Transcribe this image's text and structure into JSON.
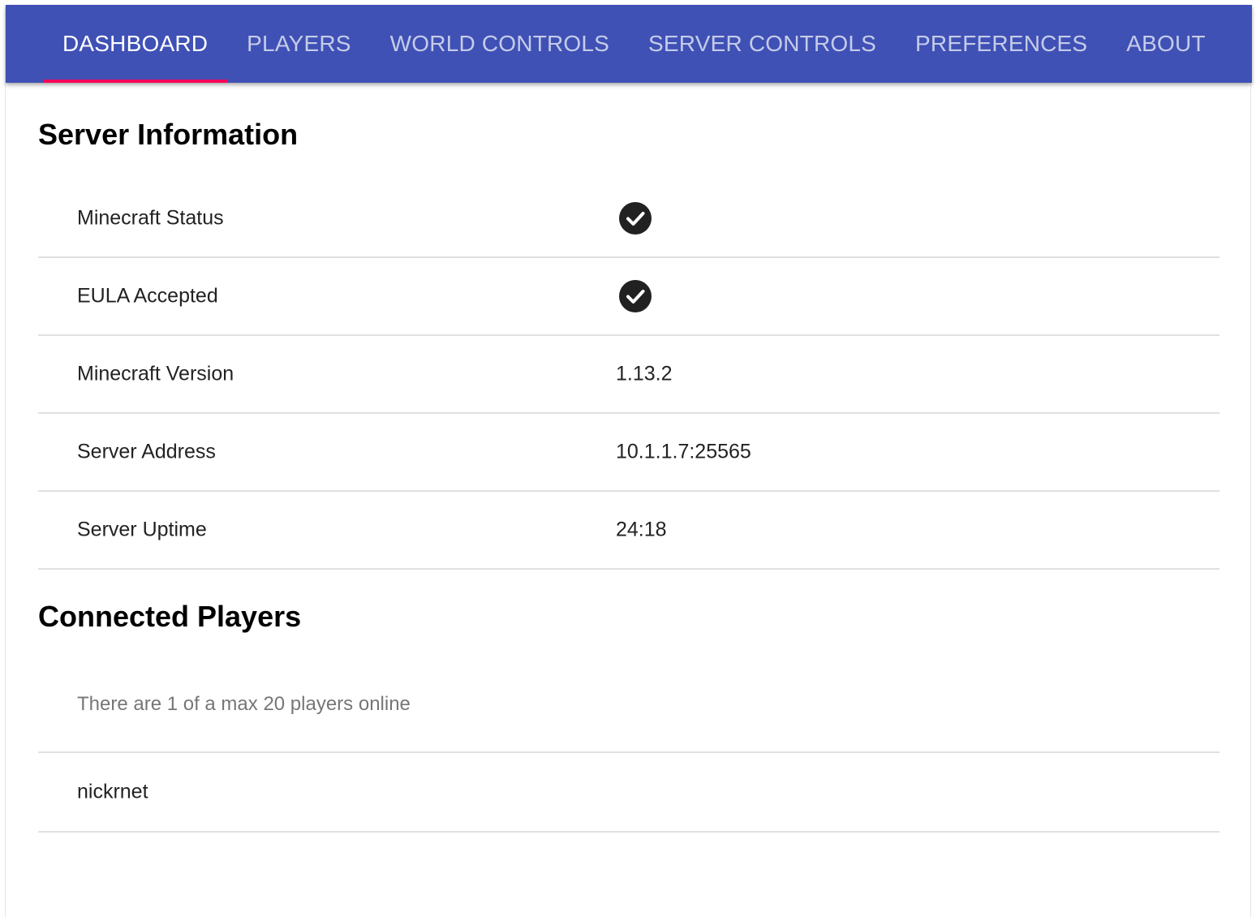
{
  "nav": {
    "tabs": [
      {
        "label": "DASHBOARD",
        "active": true
      },
      {
        "label": "PLAYERS",
        "active": false
      },
      {
        "label": "WORLD CONTROLS",
        "active": false
      },
      {
        "label": "SERVER CONTROLS",
        "active": false
      },
      {
        "label": "PREFERENCES",
        "active": false
      },
      {
        "label": "ABOUT",
        "active": false
      }
    ]
  },
  "server_info": {
    "title": "Server Information",
    "rows": [
      {
        "label": "Minecraft Status",
        "icon": "check-circle-icon"
      },
      {
        "label": "EULA Accepted",
        "icon": "check-circle-icon"
      },
      {
        "label": "Minecraft Version",
        "value": "1.13.2"
      },
      {
        "label": "Server Address",
        "value": "10.1.1.7:25565"
      },
      {
        "label": "Server Uptime",
        "value": "24:18"
      }
    ]
  },
  "players": {
    "title": "Connected Players",
    "summary": "There are 1 of a max 20 players online",
    "list": [
      "nickrnet"
    ]
  },
  "colors": {
    "appbar": "#3f51b5",
    "tab_indicator": "#f50057",
    "divider": "#e0e0e0"
  }
}
